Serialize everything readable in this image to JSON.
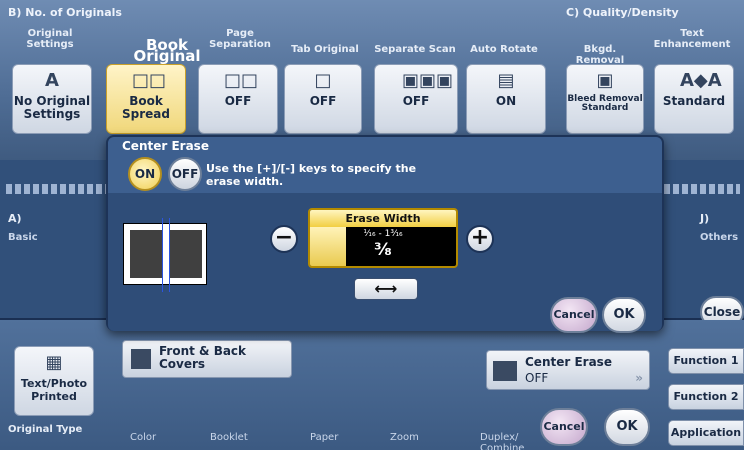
{
  "top": {
    "sectionB": "B)  No. of Originals",
    "sectionC": "C)  Quality/Density",
    "columns": [
      {
        "label": "Original Settings"
      },
      {
        "label": "Book Original"
      },
      {
        "label": "Page Separation"
      },
      {
        "label": "Tab Original"
      },
      {
        "label": "Separate Scan"
      },
      {
        "label": "Auto Rotate"
      },
      {
        "label": "Bkgd. Removal"
      },
      {
        "label": "Text Enhancement"
      }
    ],
    "tiles": [
      {
        "icon": "A",
        "text": "No Original Settings"
      },
      {
        "icon": "□□",
        "text": "Book Spread"
      },
      {
        "icon": "□□",
        "text": "OFF"
      },
      {
        "icon": "□",
        "text": "OFF"
      },
      {
        "icon": "▣▣▣",
        "text": "OFF"
      },
      {
        "icon": "▤",
        "text": "ON"
      },
      {
        "icon": "▣",
        "text": "Bleed Removal Standard"
      },
      {
        "icon": "A◆A",
        "text": "Standard"
      }
    ]
  },
  "middle": {
    "left_a": "A)",
    "left_basic": "Basic",
    "right_j": "J)",
    "right_others": "Others",
    "close": "Close"
  },
  "bottom": {
    "original_type_tile": "Text/Photo Printed",
    "original_type_label": "Original Type",
    "front_back": "Front & Back Covers",
    "center_erase_title": "Center Erase",
    "center_erase_value": "OFF",
    "bottom_labels": [
      "Color",
      "Booklet",
      "Paper",
      "Zoom",
      "Duplex/ Combine"
    ],
    "cancel": "Cancel",
    "ok": "OK",
    "function1": "Function 1",
    "function2": "Function 2",
    "application": "Application"
  },
  "dialog": {
    "title": "Center Erase",
    "on": "ON",
    "off": "OFF",
    "message_line1": "Use the [+]/[-] keys to specify the",
    "message_line2": "erase width.",
    "erase_width_label": "Erase Width",
    "range": "¹⁄₁₆ - 1³⁄₁₆",
    "value": "³⁄₈",
    "minus": "−",
    "plus": "+",
    "arrow": "⟷",
    "cancel": "Cancel",
    "ok": "OK"
  }
}
